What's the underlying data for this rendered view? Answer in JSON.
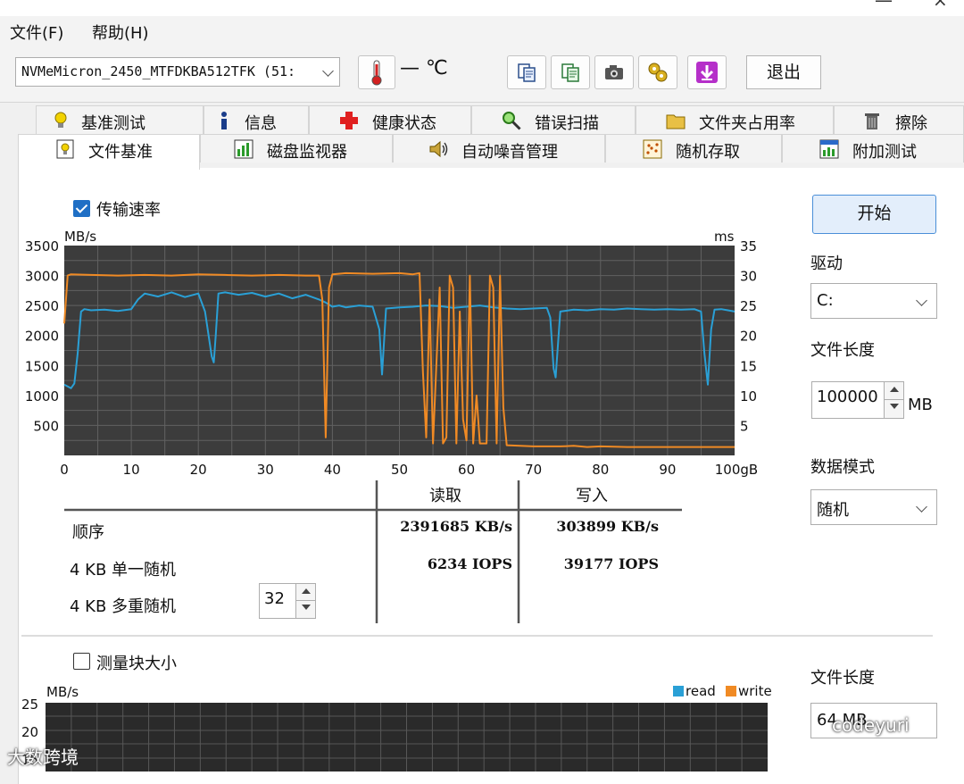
{
  "menu": {
    "file": "文件(F)",
    "help": "帮助(H)"
  },
  "toolbar": {
    "drive_value": "NVMeMicron_2450_MTFDKBA512TFK (51:",
    "temperature": "— ℃",
    "exit_label": "退出"
  },
  "tabs": {
    "row1": [
      "基准测试",
      "信息",
      "健康状态",
      "错误扫描",
      "文件夹占用率",
      "擦除"
    ],
    "row2": [
      "文件基准",
      "磁盘监视器",
      "自动噪音管理",
      "随机存取",
      "附加测试"
    ]
  },
  "transfer": {
    "checkbox_label": "传输速率",
    "y_unit_left": "MB/s",
    "y_unit_right": "ms"
  },
  "chart_data": {
    "type": "line",
    "xlabel": "",
    "ylabel": "MB/s",
    "xlim": [
      0,
      100
    ],
    "ylim": [
      0,
      3500
    ],
    "y2lim": [
      0,
      35
    ],
    "grid": true,
    "x_ticks": [
      "0",
      "10",
      "20",
      "30",
      "40",
      "50",
      "60",
      "70",
      "80",
      "90",
      "100gB"
    ],
    "y_ticks": [
      "500",
      "1000",
      "1500",
      "2000",
      "2500",
      "3000",
      "3500"
    ],
    "y2_ticks": [
      "5",
      "10",
      "15",
      "20",
      "25",
      "30",
      "35"
    ],
    "series": [
      {
        "color": "#2aa0d6",
        "x": [
          0,
          1,
          1.5,
          2,
          2.5,
          3,
          4,
          6,
          8,
          10,
          11,
          12,
          14,
          16,
          18,
          20,
          21,
          22,
          22.3,
          22.6,
          23,
          24,
          26,
          28,
          30,
          32,
          34,
          36,
          38,
          39,
          40,
          41,
          42,
          44,
          46,
          47,
          47.4,
          48,
          50,
          52,
          54,
          56,
          58,
          60,
          62,
          64,
          66,
          68,
          70,
          72,
          72.5,
          73,
          73.3,
          74,
          76,
          78,
          80,
          82,
          84,
          86,
          88,
          90,
          92,
          94,
          95,
          95.5,
          96,
          96.5,
          97,
          98,
          99,
          100
        ],
        "y": [
          1180,
          1120,
          1200,
          1700,
          2400,
          2440,
          2420,
          2430,
          2410,
          2440,
          2600,
          2700,
          2650,
          2720,
          2640,
          2700,
          2400,
          1650,
          1550,
          2000,
          2700,
          2720,
          2680,
          2710,
          2650,
          2700,
          2620,
          2680,
          2600,
          2550,
          2480,
          2500,
          2470,
          2500,
          2480,
          2100,
          1350,
          2450,
          2470,
          2480,
          2500,
          2490,
          2460,
          2480,
          2500,
          2470,
          2450,
          2440,
          2450,
          2460,
          2300,
          1450,
          1300,
          2400,
          2430,
          2420,
          2440,
          2430,
          2450,
          2440,
          2430,
          2440,
          2430,
          2440,
          2400,
          1700,
          1180,
          2100,
          2430,
          2440,
          2420,
          2400
        ]
      },
      {
        "color": "#f08a24",
        "x": [
          0,
          0.5,
          1,
          4,
          8,
          12,
          16,
          20,
          24,
          28,
          32,
          36,
          38,
          38.5,
          39,
          39.5,
          40,
          42,
          46,
          50,
          52,
          53,
          53.5,
          54,
          54.5,
          55,
          56,
          56.5,
          57,
          57.5,
          58,
          58.5,
          59,
          59.5,
          60,
          60.5,
          61,
          61.5,
          62,
          63,
          63.5,
          64,
          64.5,
          65,
          65.5,
          66,
          68,
          70,
          72,
          74,
          76,
          78,
          80,
          84,
          88,
          92,
          96,
          100
        ],
        "y": [
          2200,
          3000,
          3020,
          3010,
          3000,
          3010,
          3000,
          3020,
          3010,
          3000,
          3010,
          3000,
          3000,
          2600,
          300,
          2800,
          3020,
          3040,
          3030,
          3040,
          3020,
          3040,
          1400,
          300,
          2600,
          200,
          2800,
          200,
          300,
          3000,
          2800,
          200,
          2400,
          600,
          250,
          3000,
          200,
          1000,
          200,
          200,
          3000,
          2800,
          200,
          3000,
          800,
          170,
          160,
          150,
          150,
          150,
          160,
          140,
          150,
          140,
          140,
          140,
          140,
          140
        ]
      }
    ]
  },
  "results": {
    "header_read": "读取",
    "header_write": "写入",
    "rows": [
      {
        "label": "顺序",
        "read": "2391685 KB/s",
        "write": "303899 KB/s"
      },
      {
        "label": "4 KB 单一随机",
        "read": "6234 IOPS",
        "write": "39177 IOPS"
      },
      {
        "label": "4 KB 多重随机",
        "read": "",
        "write": ""
      }
    ],
    "queue_depth": "32"
  },
  "right_panel": {
    "start_label": "开始",
    "drive_label": "驱动",
    "drive_value": "C:",
    "file_length_label": "文件长度",
    "file_length_value": "100000",
    "file_length_unit": "MB",
    "data_mode_label": "数据模式",
    "data_mode_value": "随机",
    "file_length_label2": "文件长度",
    "file_length_value2": "64 MB"
  },
  "blocksize": {
    "checkbox_label": "测量块大小",
    "y_unit": "MB/s",
    "y_ticks": [
      "25",
      "20",
      "15"
    ],
    "legend_read": "read",
    "legend_write": "write"
  },
  "watermarks": {
    "left": "大数跨境",
    "right": "codeyuri"
  }
}
